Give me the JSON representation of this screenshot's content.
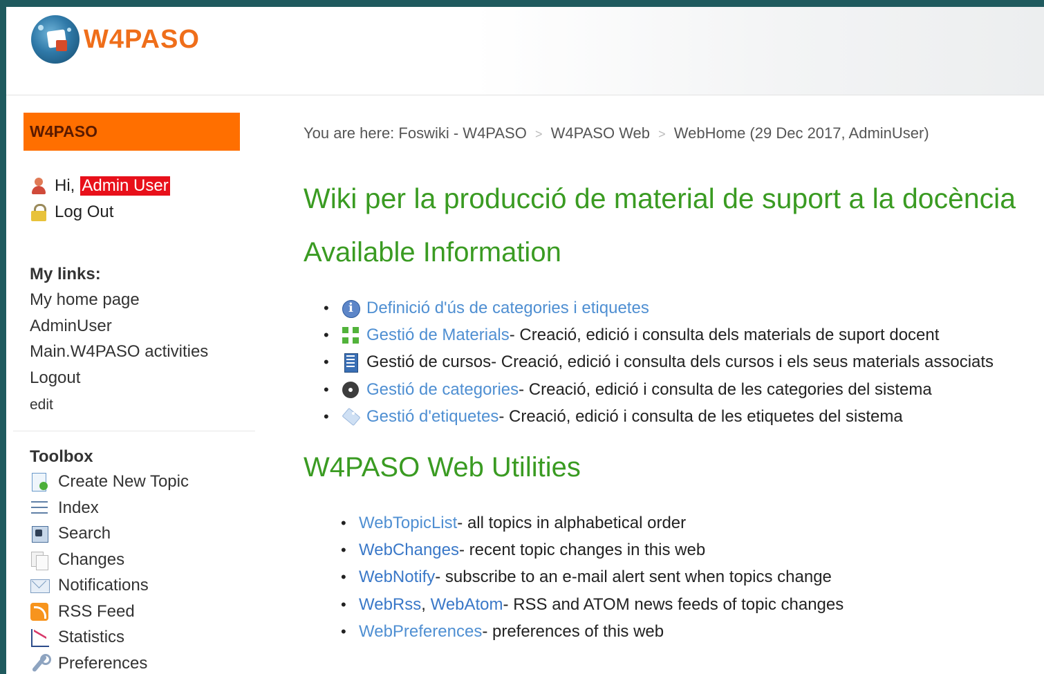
{
  "header": {
    "logo_text": "W4PASO"
  },
  "sidebar": {
    "web_title": "W4PASO",
    "greeting": "Hi,",
    "user_name": "Admin User",
    "logout_label": "Log Out",
    "my_links_title": "My links:",
    "my_links": [
      "My home page",
      "AdminUser",
      "Main.W4PASO activities",
      "Logout",
      "edit"
    ],
    "toolbox_title": "Toolbox",
    "toolbox": [
      {
        "label": "Create New Topic",
        "icon": "new-topic-icon"
      },
      {
        "label": "Index",
        "icon": "index-icon"
      },
      {
        "label": "Search",
        "icon": "search-icon"
      },
      {
        "label": "Changes",
        "icon": "changes-icon"
      },
      {
        "label": "Notifications",
        "icon": "notifications-icon"
      },
      {
        "label": "RSS Feed",
        "icon": "rss-icon"
      },
      {
        "label": "Statistics",
        "icon": "statistics-icon"
      },
      {
        "label": "Preferences",
        "icon": "preferences-icon"
      }
    ]
  },
  "breadcrumb": {
    "prefix": "You are here:",
    "items": [
      "Foswiki - W4PASO",
      "W4PASO Web",
      "WebHome (29 Dec 2017, AdminUser)"
    ],
    "separator": ">"
  },
  "main": {
    "title": "Wiki per la producció de material de suport a la docència",
    "available_title": "Available Information",
    "available": [
      {
        "icon": "info-icon",
        "link": "Definició d'ús de categories i etiquetes",
        "desc": ""
      },
      {
        "icon": "materials-icon",
        "link": "Gestió de Materials",
        "desc": " - Creació, edició i consulta dels materials de suport docent"
      },
      {
        "icon": "courses-icon",
        "link": "",
        "plain": "Gestió de cursos",
        "desc": " - Creació, edició i consulta dels cursos i els seus materials associats"
      },
      {
        "icon": "gear-icon",
        "link": "Gestió de categories",
        "desc": " - Creació, edició i consulta de les categories del sistema"
      },
      {
        "icon": "tag-icon",
        "link": "Gestió d'etiquetes",
        "desc": " - Creació, edició i consulta de les etiquetes del sistema"
      }
    ],
    "utilities_title": "W4PASO Web Utilities",
    "utilities": [
      {
        "link": "WebTopicList",
        "desc": " - all topics in alphabetical order"
      },
      {
        "link": "WebChanges",
        "desc": " - recent topic changes in this web"
      },
      {
        "link": "WebNotify",
        "desc": " - subscribe to an e-mail alert sent when topics change"
      },
      {
        "link": "WebRss",
        "link2": "WebAtom",
        "comma": ", ",
        "desc": " - RSS and ATOM news feeds of topic changes"
      },
      {
        "link": "WebPreferences",
        "desc": " - preferences of this web"
      }
    ]
  },
  "colors": {
    "accent_orange": "#ff6f00",
    "heading_green": "#3a9b22",
    "link_blue": "#4f8fd2",
    "admin_badge_red": "#e8101a"
  }
}
